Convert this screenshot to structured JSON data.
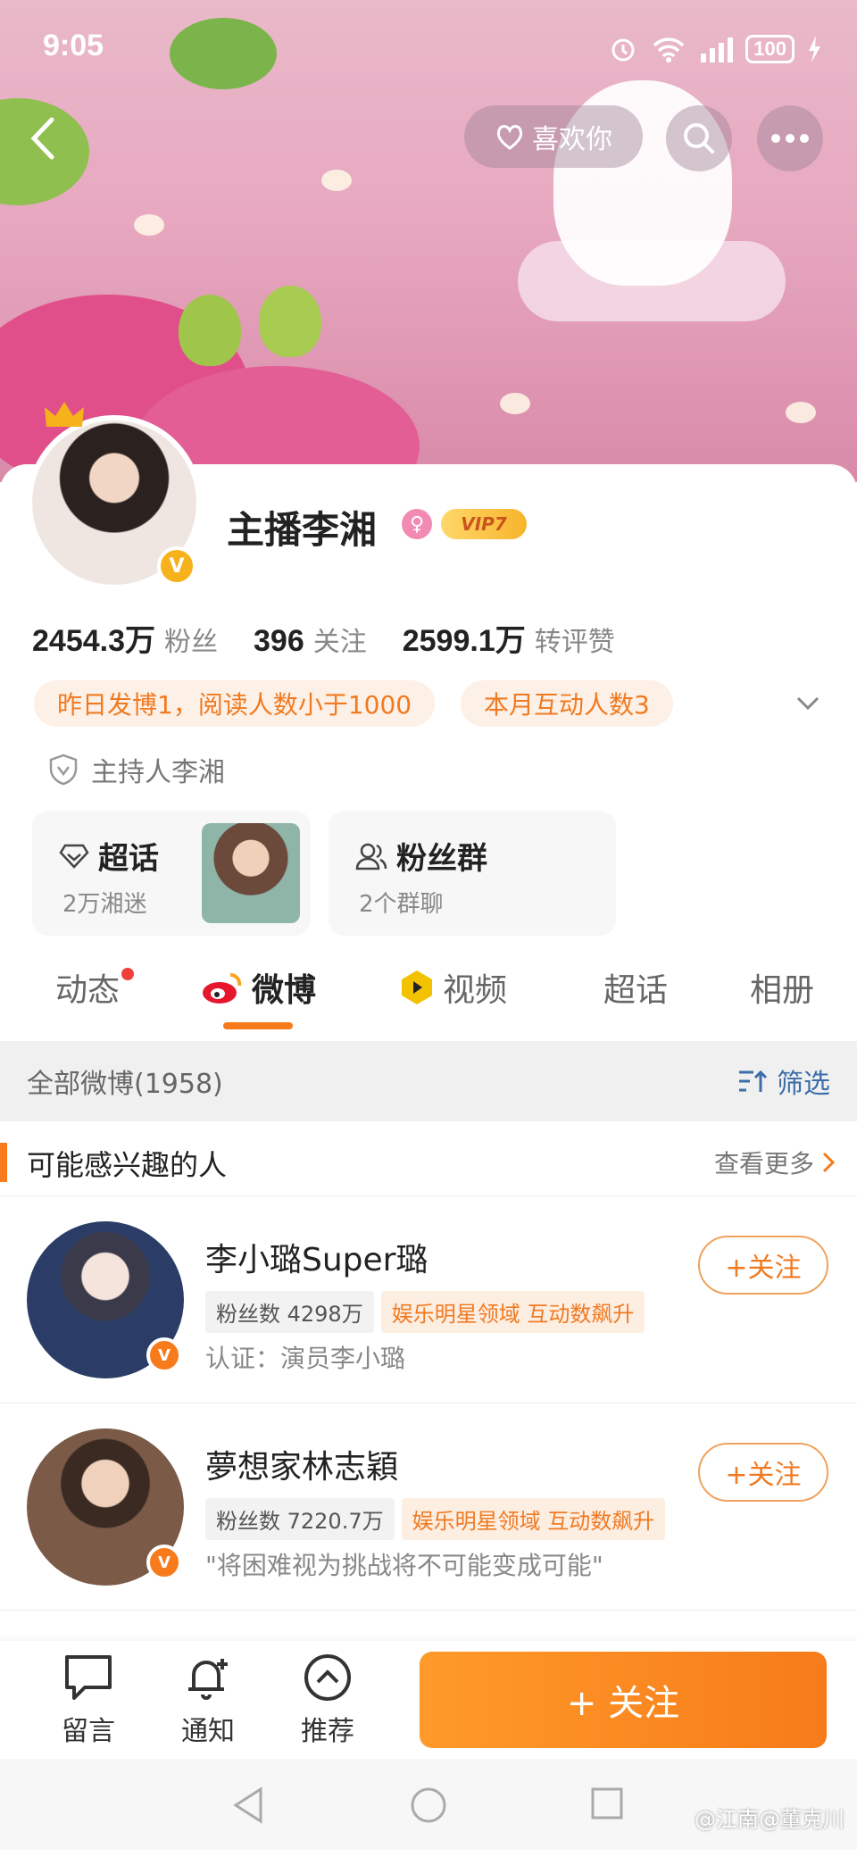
{
  "status_bar": {
    "time": "9:05",
    "battery": "100"
  },
  "header": {
    "like_label": "喜欢你"
  },
  "profile": {
    "name": "主播李湘",
    "vip_label": "VIP7",
    "stats": [
      {
        "num": "2454.3万",
        "label": "粉丝"
      },
      {
        "num": "396",
        "label": "关注"
      },
      {
        "num": "2599.1万",
        "label": "转评赞"
      }
    ],
    "pills": [
      "昨日发博1，阅读人数小于1000",
      "本月互动人数3"
    ],
    "cert": "主持人李湘",
    "supertopic": {
      "title": "超话",
      "sub": "2万湘迷"
    },
    "fangroup": {
      "title": "粉丝群",
      "sub": "2个群聊"
    }
  },
  "tabs": [
    "动态",
    "微博",
    "视频",
    "超话",
    "相册"
  ],
  "filter": {
    "count": "全部微博(1958)",
    "label": "筛选"
  },
  "section": {
    "title": "可能感兴趣的人",
    "more": "查看更多"
  },
  "recommendations": [
    {
      "name": "李小璐Super璐",
      "fans": "粉丝数 4298万",
      "tag": "娱乐明星领域 互动数飙升",
      "desc": "认证：演员李小璐",
      "follow": "+关注"
    },
    {
      "name": "夢想家林志穎",
      "fans": "粉丝数 7220.7万",
      "tag": "娱乐明星领域 互动数飙升",
      "desc": "\"将困难视为挑战将不可能变成可能\"",
      "follow": "+关注"
    }
  ],
  "bottom_bar": {
    "comment": "留言",
    "notify": "通知",
    "recommend": "推荐",
    "follow": "+ 关注"
  },
  "watermark": "@江南@董克川",
  "colors": {
    "accent": "#f77b1a",
    "blue": "#3b6ea8"
  }
}
